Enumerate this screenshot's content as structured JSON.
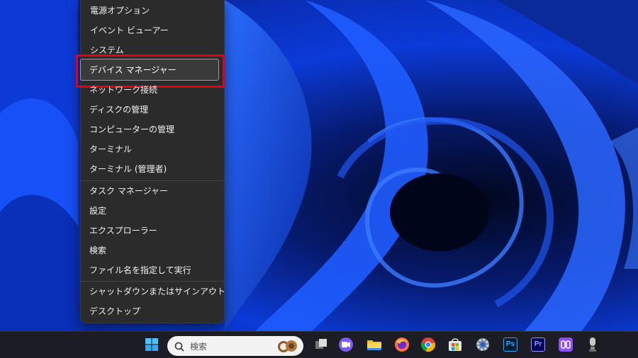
{
  "context_menu": {
    "items": [
      {
        "label": "電源オプション"
      },
      {
        "label": "イベント ビューアー"
      },
      {
        "label": "システム"
      },
      {
        "label": "デバイス マネージャー"
      },
      {
        "label": "ネットワーク接続"
      },
      {
        "label": "ディスクの管理"
      },
      {
        "label": "コンピューターの管理"
      },
      {
        "label": "ターミナル"
      },
      {
        "label": "ターミナル (管理者)"
      },
      {
        "label": "タスク マネージャー"
      },
      {
        "label": "設定"
      },
      {
        "label": "エクスプローラー"
      },
      {
        "label": "検索"
      },
      {
        "label": "ファイル名を指定して実行"
      },
      {
        "label": "シャットダウンまたはサインアウト",
        "submenu_arrow": "›"
      },
      {
        "label": "デスクトップ"
      }
    ],
    "highlighted_item": "デバイス マネージャー",
    "highlight_color": "#e60012"
  },
  "taskbar": {
    "search_placeholder": "検索",
    "icons": [
      "windows-start-icon",
      "search-icon",
      "task-view-icon",
      "video-chat-icon",
      "file-explorer-icon",
      "firefox-icon",
      "chrome-icon",
      "microsoft-store-icon",
      "settings-icon",
      "photoshop-icon",
      "premiere-icon",
      "copilot-icon",
      "microphone-app-icon"
    ],
    "photoshop_label": "Ps",
    "premiere_label": "Pr"
  }
}
